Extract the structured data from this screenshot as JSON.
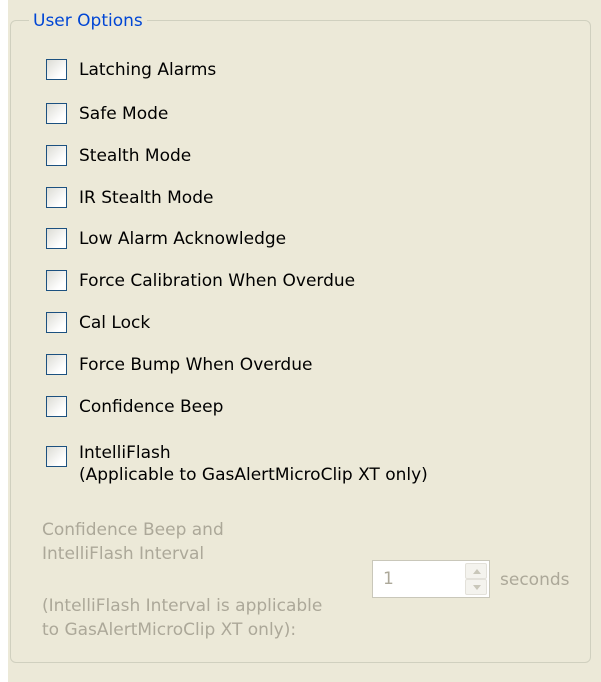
{
  "group": {
    "title": "User Options"
  },
  "options": [
    {
      "label": "Latching Alarms",
      "checked": false
    },
    {
      "label": "Safe Mode",
      "checked": false
    },
    {
      "label": "Stealth Mode",
      "checked": false
    },
    {
      "label": "IR Stealth Mode",
      "checked": false
    },
    {
      "label": "Low Alarm Acknowledge",
      "checked": false
    },
    {
      "label": "Force Calibration When Overdue",
      "checked": false
    },
    {
      "label": "Cal Lock",
      "checked": false
    },
    {
      "label": "Force Bump When Overdue",
      "checked": false
    },
    {
      "label": "Confidence Beep",
      "checked": false
    },
    {
      "label": "IntelliFlash",
      "label_line2": "(Applicable to GasAlertMicroClip XT only)",
      "checked": false
    }
  ],
  "interval": {
    "label_line1": "Confidence Beep and",
    "label_line2": "IntelliFlash Interval",
    "note_line1": "(IntelliFlash Interval is applicable",
    "note_line2": "to GasAlertMicroClip XT only):",
    "value": "1",
    "unit": "seconds",
    "enabled": false
  },
  "colors": {
    "panel_bg": "#ece9d8",
    "group_title": "#0046d5",
    "disabled_text": "#aca899",
    "checkbox_border": "#1c5180"
  },
  "icons": {
    "spin_up": "up-arrow-icon",
    "spin_down": "down-arrow-icon"
  }
}
